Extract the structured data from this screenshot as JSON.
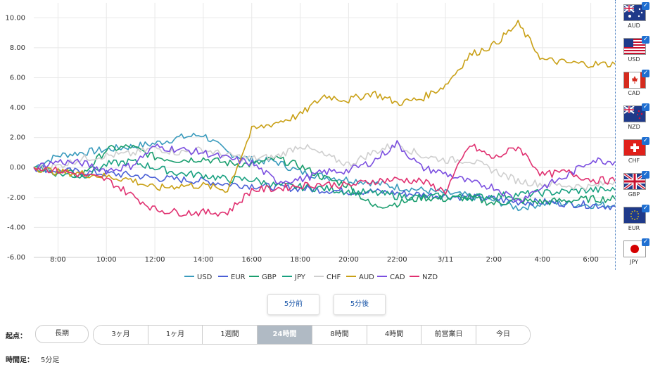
{
  "chart_data": {
    "type": "line",
    "title": "",
    "xlabel": "",
    "ylabel": "",
    "ylim": [
      -6,
      11
    ],
    "yticks": [
      -6,
      -4,
      -2,
      0,
      2,
      4,
      6,
      8,
      10
    ],
    "ytick_labels": [
      "-6.00",
      "-4.00",
      "-2.00",
      "0.00",
      "2.00",
      "4.00",
      "6.00",
      "8.00",
      "10.00"
    ],
    "x_hours": [
      7,
      8,
      9,
      10,
      11,
      12,
      13,
      14,
      15,
      16,
      17,
      18,
      19,
      20,
      21,
      22,
      23,
      24,
      25,
      26,
      27,
      28,
      29,
      30,
      31
    ],
    "x_range": [
      7,
      31
    ],
    "xtick_hours": [
      8,
      10,
      12,
      14,
      16,
      18,
      20,
      22,
      24,
      26,
      28,
      30
    ],
    "xtick_labels": [
      "8:00",
      "10:00",
      "12:00",
      "14:00",
      "16:00",
      "18:00",
      "20:00",
      "22:00",
      "3/11",
      "2:00",
      "4:00",
      "6:00"
    ],
    "grid": true,
    "legend_position": "bottom",
    "series": [
      {
        "name": "USD",
        "color": "#3a9bbd",
        "values": [
          0.0,
          0.8,
          1.0,
          1.2,
          1.4,
          1.6,
          2.0,
          2.2,
          1.0,
          0.5,
          0.4,
          -0.3,
          -0.6,
          -0.8,
          -1.0,
          -1.3,
          -1.5,
          -1.7,
          -1.9,
          -2.2,
          -2.7,
          -2.4,
          -2.4,
          -2.5,
          -2.5
        ]
      },
      {
        "name": "EUR",
        "color": "#4a5fd6",
        "values": [
          0.0,
          -0.2,
          -0.3,
          -0.4,
          -0.5,
          -0.7,
          -0.8,
          -0.9,
          -1.1,
          -1.2,
          -1.3,
          -1.4,
          -1.5,
          -1.6,
          -1.6,
          -1.7,
          -1.8,
          -1.9,
          -2.0,
          -2.1,
          -2.3,
          -2.3,
          -2.4,
          -2.5,
          -2.6
        ]
      },
      {
        "name": "GBP",
        "color": "#1a9e6e",
        "values": [
          0.0,
          -0.3,
          -0.5,
          1.2,
          1.4,
          0.7,
          0.5,
          0.6,
          0.3,
          0.2,
          0.6,
          0.1,
          -0.7,
          -1.2,
          -2.6,
          -2.4,
          -2.0,
          -2.1,
          -2.0,
          -2.4,
          -2.2,
          -2.3,
          -2.2,
          -2.1,
          -2.1
        ]
      },
      {
        "name": "JPY",
        "color": "#18a080",
        "values": [
          0.0,
          -0.4,
          -0.6,
          0.2,
          0.4,
          0.0,
          -0.4,
          -0.5,
          -0.8,
          -0.8,
          -1.2,
          -1.3,
          -1.4,
          -1.6,
          -1.7,
          -1.9,
          -2.0,
          -1.9,
          -2.0,
          -1.9,
          -1.8,
          -1.7,
          -1.6,
          -1.5,
          -1.5
        ]
      },
      {
        "name": "CHF",
        "color": "#cfcfcf",
        "values": [
          0.0,
          0.1,
          0.6,
          0.8,
          0.9,
          1.3,
          1.0,
          1.2,
          0.8,
          0.6,
          0.7,
          1.5,
          0.8,
          0.2,
          1.0,
          1.6,
          0.8,
          0.5,
          0.5,
          -0.2,
          -0.9,
          -1.1,
          -1.2,
          -1.3,
          -0.9
        ]
      },
      {
        "name": "AUD",
        "color": "#c9a016",
        "values": [
          0.0,
          -0.3,
          -0.4,
          -0.6,
          -0.8,
          -1.4,
          -1.2,
          -1.2,
          -1.5,
          2.5,
          3.0,
          3.5,
          4.8,
          4.5,
          5.0,
          4.3,
          4.6,
          5.5,
          7.5,
          8.2,
          9.6,
          7.2,
          7.0,
          6.9,
          6.9
        ]
      },
      {
        "name": "CAD",
        "color": "#7b4fe0",
        "values": [
          0.0,
          0.4,
          0.3,
          -0.2,
          0.1,
          1.4,
          1.2,
          1.0,
          0.6,
          0.3,
          -0.9,
          -0.8,
          -0.3,
          -0.2,
          0.4,
          1.6,
          0.0,
          -0.4,
          -1.0,
          -1.3,
          -2.2,
          -1.3,
          -0.6,
          0.5,
          0.4
        ]
      },
      {
        "name": "NZD",
        "color": "#e03070",
        "values": [
          0.0,
          -0.2,
          -0.5,
          -0.8,
          -1.8,
          -2.8,
          -3.0,
          -3.0,
          -3.0,
          -1.5,
          -1.4,
          -1.2,
          -1.1,
          -1.2,
          -0.9,
          -0.8,
          -0.9,
          -1.6,
          1.5,
          0.6,
          1.4,
          -0.5,
          -0.3,
          -0.8,
          -0.9
        ]
      }
    ]
  },
  "flags": [
    {
      "code": "AUD",
      "icon": "aus-flag-icon"
    },
    {
      "code": "USD",
      "icon": "usa-flag-icon"
    },
    {
      "code": "CAD",
      "icon": "canada-flag-icon"
    },
    {
      "code": "NZD",
      "icon": "nz-flag-icon"
    },
    {
      "code": "CHF",
      "icon": "swiss-flag-icon"
    },
    {
      "code": "GBP",
      "icon": "uk-flag-icon"
    },
    {
      "code": "EUR",
      "icon": "eu-flag-icon"
    },
    {
      "code": "JPY",
      "icon": "japan-flag-icon"
    }
  ],
  "nav": {
    "prev_label": "5分前",
    "next_label": "5分後"
  },
  "range": {
    "label": "起点：",
    "long_label": "長期",
    "options": [
      "3ヶ月",
      "1ヶ月",
      "1週間",
      "24時間",
      "8時間",
      "4時間",
      "前営業日",
      "今日"
    ],
    "selected": "24時間"
  },
  "timeframe": {
    "label": "時間足：",
    "value": "5分足"
  },
  "colors": {
    "accent": "#1f6fd1",
    "active_segment": "#b0bac4",
    "link": "#1a56a8"
  }
}
